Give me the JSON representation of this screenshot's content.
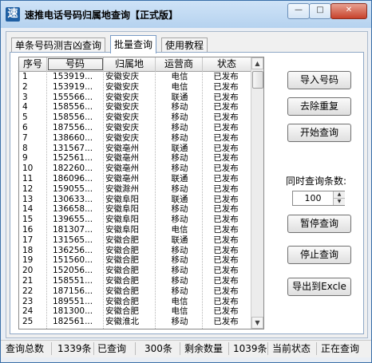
{
  "window": {
    "icon_glyph": "速",
    "title": "速推电话号码归属地查询【正式版】",
    "min_glyph": "—",
    "max_glyph": "□",
    "close_glyph": "✕"
  },
  "tabs": [
    {
      "label": "单条号码测吉凶查询",
      "active": false
    },
    {
      "label": "批量查询",
      "active": true
    },
    {
      "label": "使用教程",
      "active": false
    }
  ],
  "grid": {
    "headers": [
      "序号",
      "号码",
      "归属地",
      "运营商",
      "状态"
    ],
    "rows": [
      {
        "no": "1",
        "phone": "153919...",
        "location": "安徽安庆",
        "operator": "电信",
        "status": "已发布"
      },
      {
        "no": "2",
        "phone": "153919...",
        "location": "安徽安庆",
        "operator": "电信",
        "status": "已发布"
      },
      {
        "no": "3",
        "phone": "155566...",
        "location": "安徽安庆",
        "operator": "联通",
        "status": "已发布"
      },
      {
        "no": "4",
        "phone": "158556...",
        "location": "安徽安庆",
        "operator": "移动",
        "status": "已发布"
      },
      {
        "no": "5",
        "phone": "158556...",
        "location": "安徽安庆",
        "operator": "移动",
        "status": "已发布"
      },
      {
        "no": "6",
        "phone": "187556...",
        "location": "安徽安庆",
        "operator": "移动",
        "status": "已发布"
      },
      {
        "no": "7",
        "phone": "138660...",
        "location": "安徽安庆",
        "operator": "移动",
        "status": "已发布"
      },
      {
        "no": "8",
        "phone": "131567...",
        "location": "安徽亳州",
        "operator": "联通",
        "status": "已发布"
      },
      {
        "no": "9",
        "phone": "152561...",
        "location": "安徽亳州",
        "operator": "移动",
        "status": "已发布"
      },
      {
        "no": "10",
        "phone": "182260...",
        "location": "安徽亳州",
        "operator": "移动",
        "status": "已发布"
      },
      {
        "no": "11",
        "phone": "186096...",
        "location": "安徽亳州",
        "operator": "联通",
        "status": "已发布"
      },
      {
        "no": "12",
        "phone": "159055...",
        "location": "安徽滁州",
        "operator": "移动",
        "status": "已发布"
      },
      {
        "no": "13",
        "phone": "130633...",
        "location": "安徽阜阳",
        "operator": "联通",
        "status": "已发布"
      },
      {
        "no": "14",
        "phone": "136658...",
        "location": "安徽阜阳",
        "operator": "移动",
        "status": "已发布"
      },
      {
        "no": "15",
        "phone": "139655...",
        "location": "安徽阜阳",
        "operator": "移动",
        "status": "已发布"
      },
      {
        "no": "16",
        "phone": "181307...",
        "location": "安徽阜阳",
        "operator": "电信",
        "status": "已发布"
      },
      {
        "no": "17",
        "phone": "131565...",
        "location": "安徽合肥",
        "operator": "联通",
        "status": "已发布"
      },
      {
        "no": "18",
        "phone": "136256...",
        "location": "安徽合肥",
        "operator": "移动",
        "status": "已发布"
      },
      {
        "no": "19",
        "phone": "151560...",
        "location": "安徽合肥",
        "operator": "移动",
        "status": "已发布"
      },
      {
        "no": "20",
        "phone": "152056...",
        "location": "安徽合肥",
        "operator": "移动",
        "status": "已发布"
      },
      {
        "no": "21",
        "phone": "158551...",
        "location": "安徽合肥",
        "operator": "移动",
        "status": "已发布"
      },
      {
        "no": "22",
        "phone": "187156...",
        "location": "安徽合肥",
        "operator": "移动",
        "status": "已发布"
      },
      {
        "no": "23",
        "phone": "189551...",
        "location": "安徽合肥",
        "operator": "电信",
        "status": "已发布"
      },
      {
        "no": "24",
        "phone": "181300...",
        "location": "安徽合肥",
        "operator": "电信",
        "status": "已发布"
      },
      {
        "no": "25",
        "phone": "182561...",
        "location": "安徽淮北",
        "operator": "移动",
        "status": "已发布"
      }
    ],
    "scroll_up_glyph": "▲",
    "scroll_down_glyph": "▼"
  },
  "actions": {
    "import_label": "导入号码",
    "dedupe_label": "去除重复",
    "start_label": "开始查询",
    "concurrent_label": "同时查询条数:",
    "concurrent_value": "100",
    "spin_up_glyph": "▲",
    "spin_down_glyph": "▼",
    "pause_label": "暂停查询",
    "stop_label": "停止查询",
    "export_label": "导出到Excle"
  },
  "status_bar": {
    "total_label": "查询总数",
    "total_value": "1339条",
    "queried_label": "已查询",
    "queried_value": "300条",
    "remaining_label": "剩余数量",
    "remaining_value": "1039条",
    "state_label": "当前状态",
    "state_value": "正在查询"
  }
}
